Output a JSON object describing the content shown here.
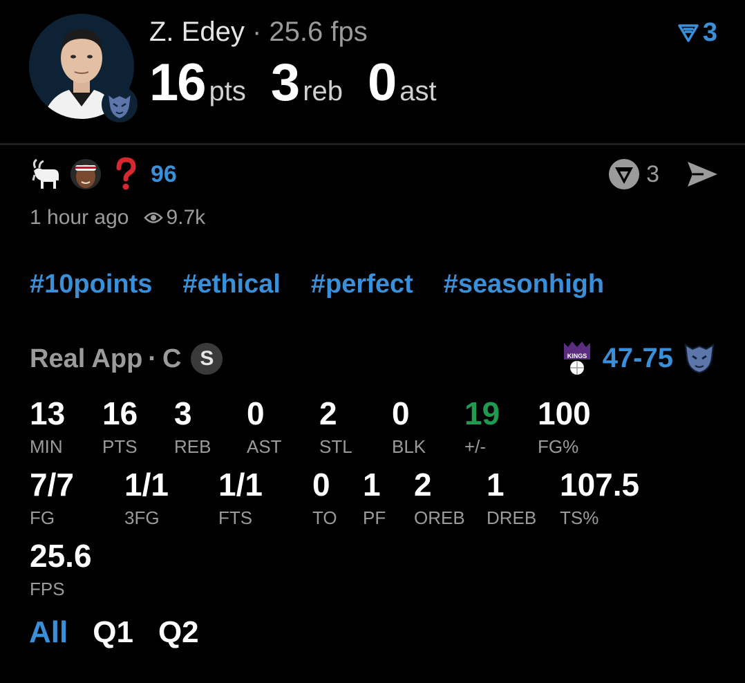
{
  "header": {
    "player_name": "Z. Edey",
    "separator": "·",
    "fps_text": "25.6 fps",
    "pts_value": "16",
    "pts_unit": "pts",
    "reb_value": "3",
    "reb_unit": "reb",
    "ast_value": "0",
    "ast_unit": "ast",
    "filter_count": "3",
    "avatar_icon": "player-avatar",
    "team_icon": "grizzlies-logo"
  },
  "post": {
    "reaction_icons": [
      "goat-emoji",
      "player-face-emoji",
      "question-mark-emoji"
    ],
    "reaction_count": "96",
    "vote_count": "3",
    "time_ago": "1 hour ago",
    "views": "9.7k",
    "tags": [
      "#10points",
      "#ethical",
      "#perfect",
      "#seasonhigh"
    ]
  },
  "game": {
    "source": "Real App",
    "separator": "·",
    "position": "C",
    "badge": "S",
    "score": "47-75",
    "away_team_icon": "kings-logo",
    "home_team_icon": "grizzlies-logo"
  },
  "stats_row1": [
    {
      "value": "13",
      "label": "MIN"
    },
    {
      "value": "16",
      "label": "PTS"
    },
    {
      "value": "3",
      "label": "REB"
    },
    {
      "value": "0",
      "label": "AST"
    },
    {
      "value": "2",
      "label": "STL"
    },
    {
      "value": "0",
      "label": "BLK"
    },
    {
      "value": "19",
      "label": "+/-"
    },
    {
      "value": "100",
      "label": "FG%"
    }
  ],
  "stats_row2": [
    {
      "value": "7/7",
      "label": "FG"
    },
    {
      "value": "1/1",
      "label": "3FG"
    },
    {
      "value": "1/1",
      "label": "FTS"
    },
    {
      "value": "0",
      "label": "TO"
    },
    {
      "value": "1",
      "label": "PF"
    },
    {
      "value": "2",
      "label": "OREB"
    },
    {
      "value": "1",
      "label": "DREB"
    },
    {
      "value": "107.5",
      "label": "TS%"
    }
  ],
  "stats_row3": [
    {
      "value": "25.6",
      "label": "FPS"
    }
  ],
  "tabs": [
    "All",
    "Q1",
    "Q2"
  ],
  "colors": {
    "accent": "#3a8fd9",
    "positive": "#1f9a4f",
    "muted": "#9b9b9b",
    "kings_purple": "#5a2d81"
  }
}
